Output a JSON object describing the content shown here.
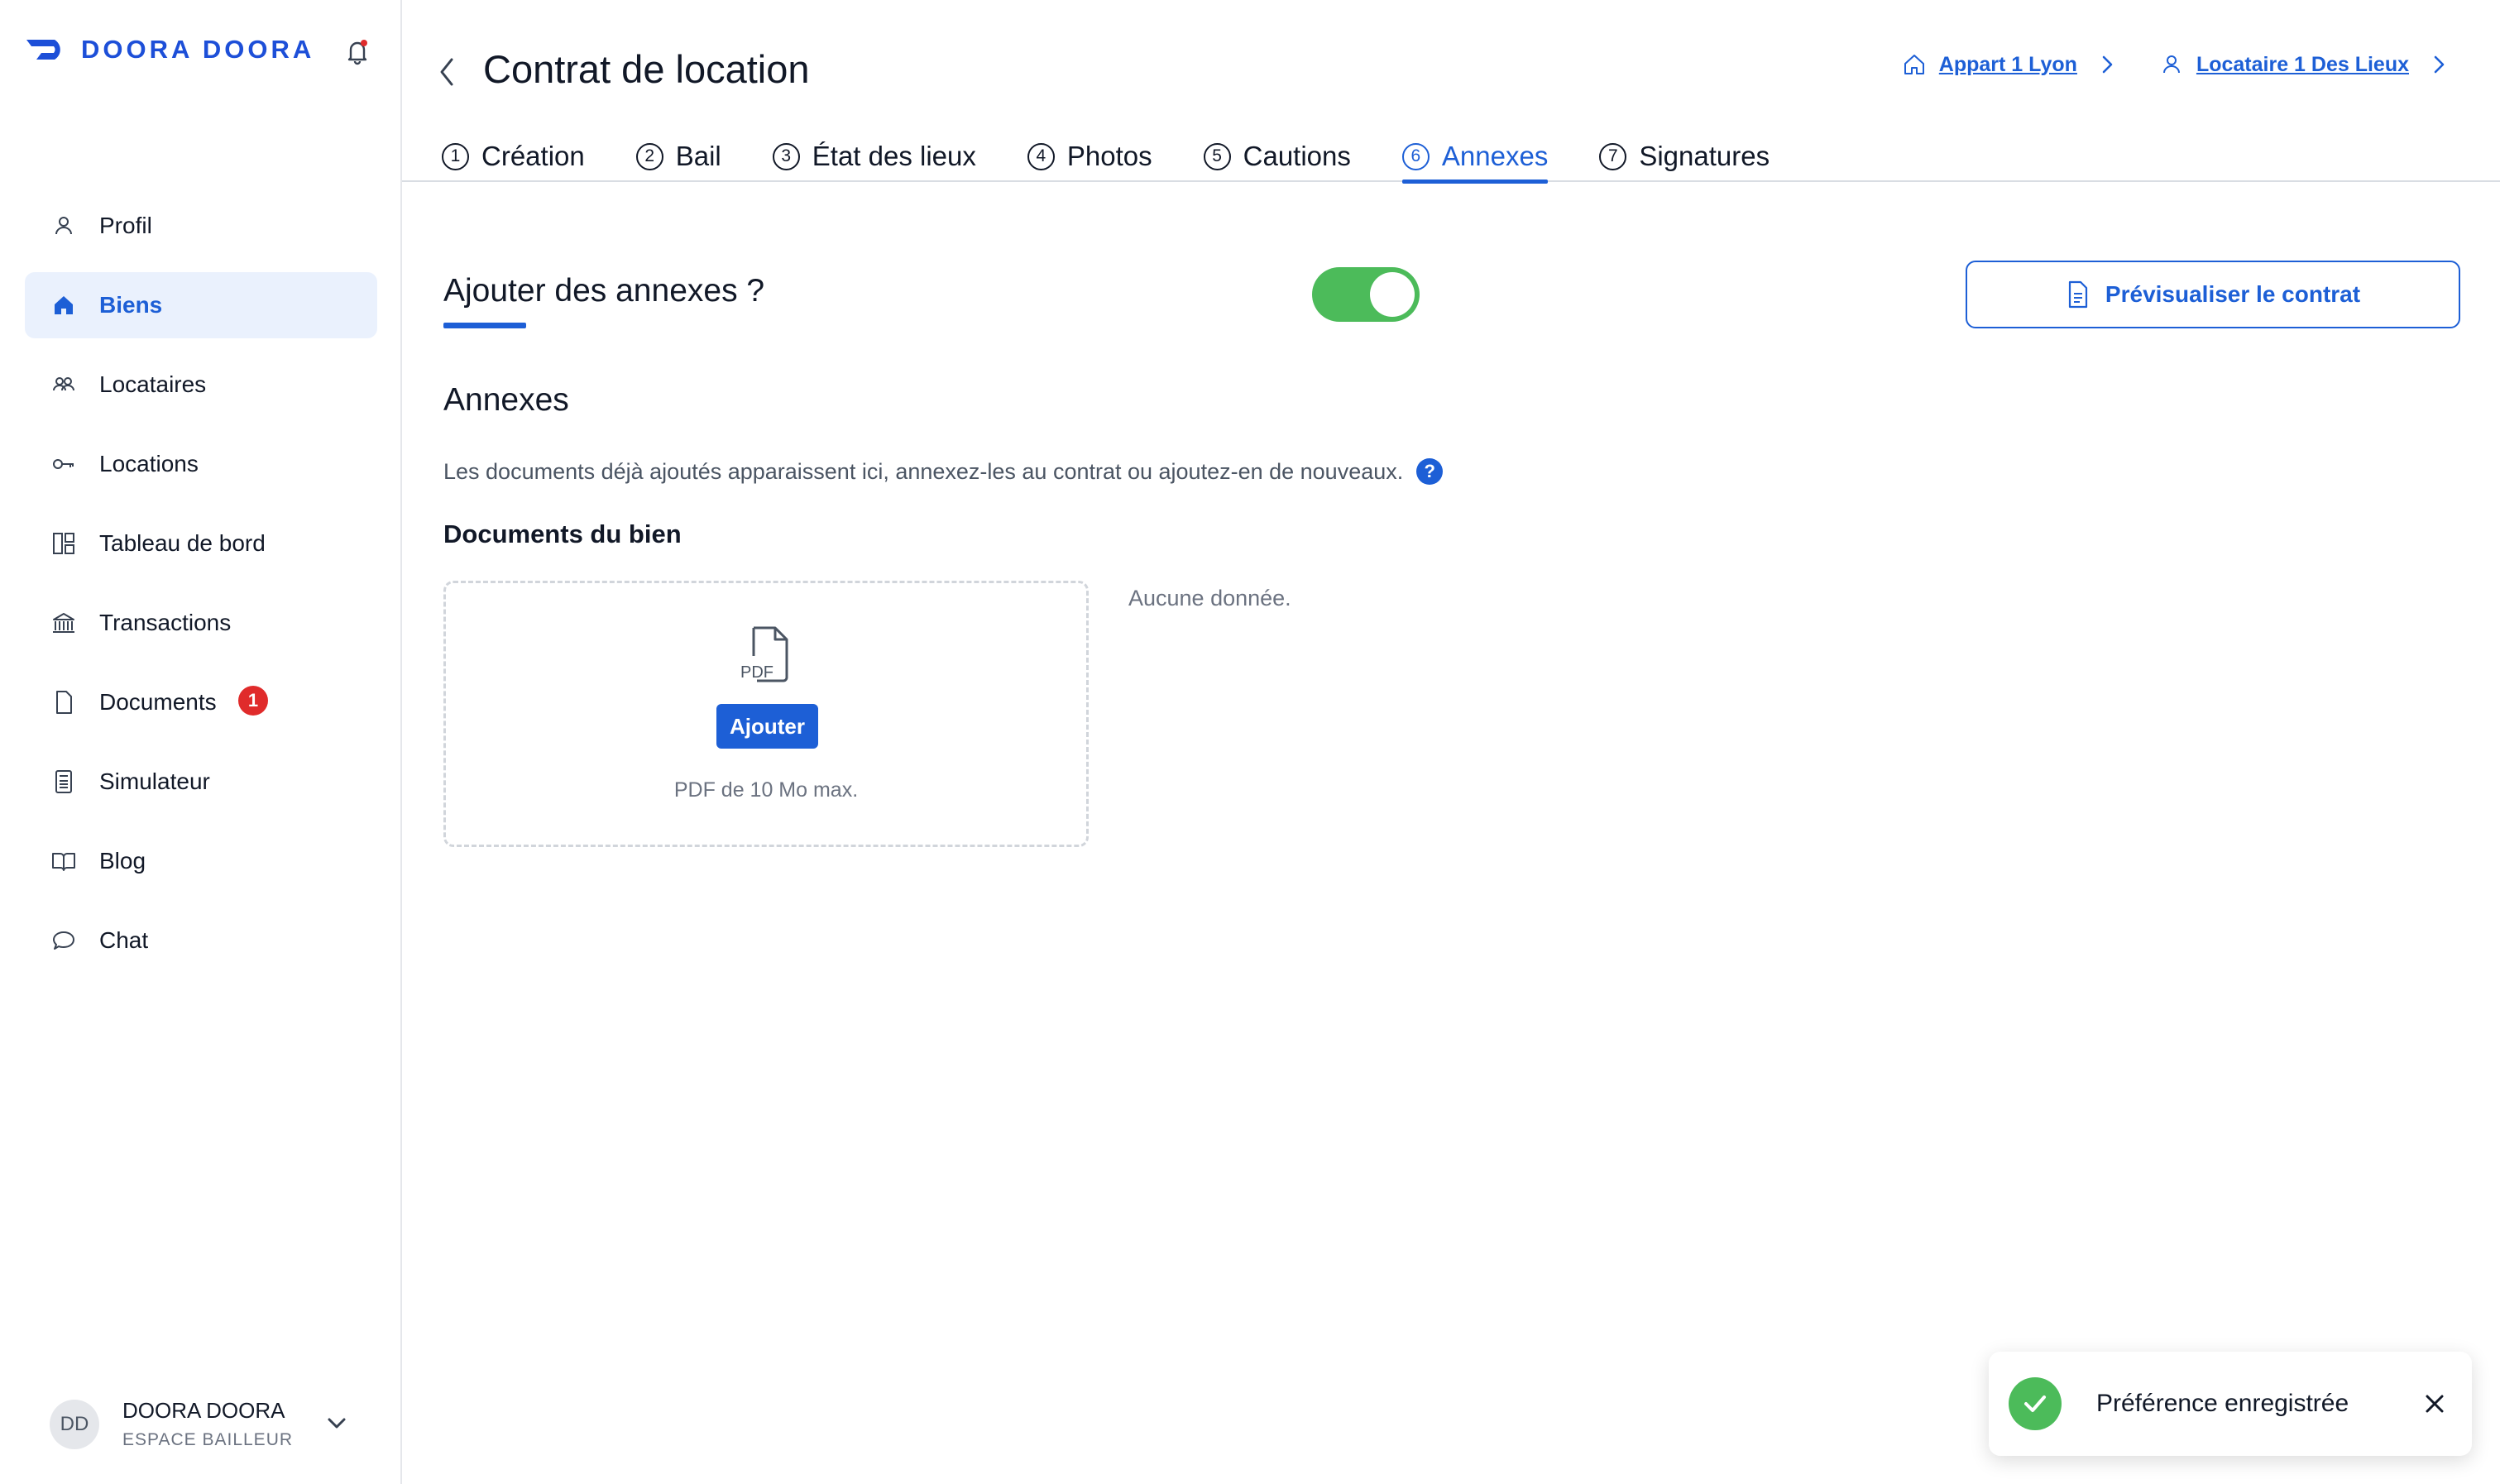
{
  "brand": {
    "name": "DOORA DOORA",
    "accent": "#1d5fd6",
    "success": "#4cbb5a"
  },
  "sidebar": {
    "items": [
      {
        "label": "Profil",
        "icon": "user-icon",
        "active": false
      },
      {
        "label": "Biens",
        "icon": "home-icon",
        "active": true
      },
      {
        "label": "Locataires",
        "icon": "users-icon",
        "active": false
      },
      {
        "label": "Locations",
        "icon": "key-icon",
        "active": false
      },
      {
        "label": "Tableau de bord",
        "icon": "dashboard-icon",
        "active": false
      },
      {
        "label": "Transactions",
        "icon": "bank-icon",
        "active": false
      },
      {
        "label": "Documents",
        "icon": "document-icon",
        "active": false,
        "badge": "1"
      },
      {
        "label": "Simulateur",
        "icon": "calculator-icon",
        "active": false
      },
      {
        "label": "Blog",
        "icon": "book-icon",
        "active": false
      },
      {
        "label": "Chat",
        "icon": "chat-icon",
        "active": false
      }
    ],
    "user": {
      "initials": "DD",
      "name": "DOORA DOORA",
      "role": "ESPACE BAILLEUR"
    }
  },
  "header": {
    "title": "Contrat de location",
    "breadcrumbs": [
      {
        "label": "Appart 1 Lyon",
        "icon": "home-outline-icon"
      },
      {
        "label": "Locataire 1 Des Lieux",
        "icon": "user-icon"
      }
    ]
  },
  "tabs": [
    {
      "num": "1",
      "label": "Création",
      "active": false
    },
    {
      "num": "2",
      "label": "Bail",
      "active": false
    },
    {
      "num": "3",
      "label": "État des lieux",
      "active": false
    },
    {
      "num": "4",
      "label": "Photos",
      "active": false
    },
    {
      "num": "5",
      "label": "Cautions",
      "active": false
    },
    {
      "num": "6",
      "label": "Annexes",
      "active": true
    },
    {
      "num": "7",
      "label": "Signatures",
      "active": false
    }
  ],
  "main": {
    "question": "Ajouter des annexes ?",
    "toggle_on": true,
    "preview_label": "Prévisualiser le contrat",
    "annexes_title": "Annexes",
    "description": "Les documents déjà ajoutés apparaissent ici, annexez-les au contrat ou ajoutez-en de nouveaux.",
    "help_glyph": "?",
    "docs_title": "Documents du bien",
    "pdf_label": "PDF",
    "add_label": "Ajouter",
    "upload_hint": "PDF de 10 Mo max.",
    "empty_text": "Aucune donnée."
  },
  "toast": {
    "message": "Préférence enregistrée"
  }
}
